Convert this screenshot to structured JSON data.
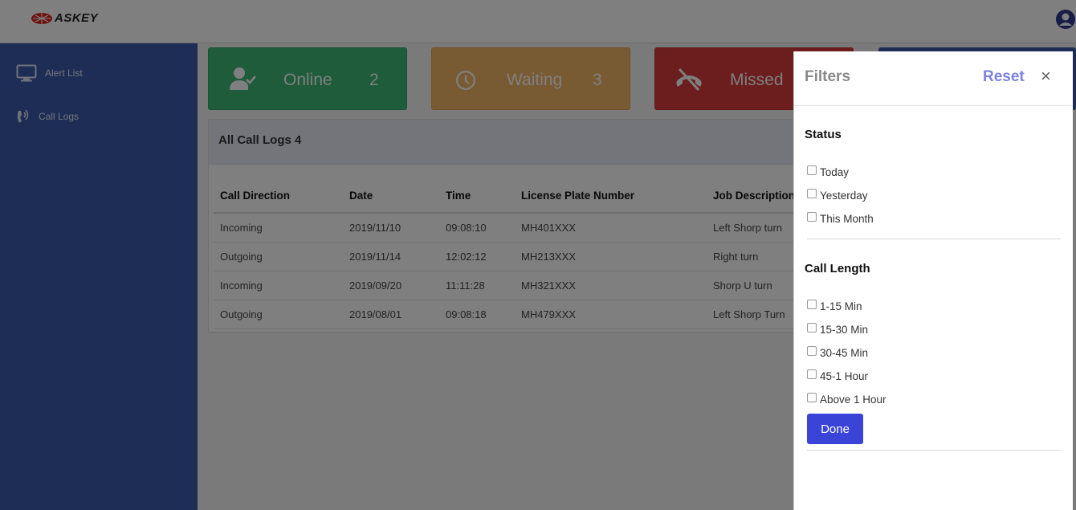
{
  "header": {
    "logo_text": "ASKEY"
  },
  "sidebar": {
    "items": [
      {
        "label": "Alert List",
        "icon": "monitor-icon"
      },
      {
        "label": "Call Logs",
        "icon": "phone-ringing-icon"
      }
    ]
  },
  "cards": {
    "online": {
      "label": "Online",
      "count": "2",
      "icon": "user-check-icon",
      "color": "#3fb878"
    },
    "waiting": {
      "label": "Waiting",
      "count": "3",
      "icon": "clock-icon",
      "color": "#f1b766"
    },
    "missed": {
      "label": "Missed",
      "icon": "phone-missed-icon",
      "color": "#d83c3c"
    }
  },
  "call_logs": {
    "title": "All Call Logs 4",
    "columns": [
      "Call Direction",
      "Date",
      "Time",
      "License Plate Number",
      "Job Description"
    ],
    "rows": [
      [
        "Incoming",
        "2019/11/10",
        "09:08:10",
        "MH401XXX",
        "Left Shorp turn"
      ],
      [
        "Outgoing",
        "2019/11/14",
        "12:02:12",
        "MH213XXX",
        "Right turn"
      ],
      [
        "Incoming",
        "2019/09/20",
        "11:11:28",
        "MH321XXX",
        "Shorp U turn"
      ],
      [
        "Outgoing",
        "2019/08/01",
        "09:08:18",
        "MH479XXX",
        "Left Shorp Turn"
      ]
    ]
  },
  "filters": {
    "title": "Filters",
    "reset_label": "Reset",
    "close_label": "×",
    "status": {
      "title": "Status",
      "options": [
        "Today",
        "Yesterday",
        "This Month"
      ]
    },
    "call_length": {
      "title": "Call Length",
      "options": [
        "1-15 Min",
        "15-30 Min",
        "30-45 Min",
        "45-1 Hour",
        "Above 1 Hour"
      ]
    },
    "done_label": "Done"
  },
  "colors": {
    "sidebar": "#3b5aab",
    "accent": "#3a45d8",
    "reset": "#7b82e0"
  }
}
